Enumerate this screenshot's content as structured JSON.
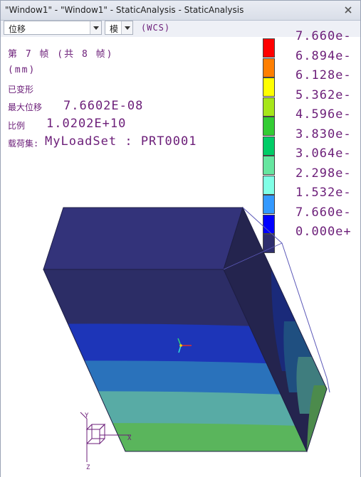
{
  "window": {
    "title": "\"Window1\" - \"Window1\" - StaticAnalysis - StaticAnalysis"
  },
  "toolbar": {
    "quantity_select": "位移",
    "component_select": "模",
    "csys": "(WCS)"
  },
  "info": {
    "frame": "第 7 帧 (共 8 帧)",
    "units": "(mm)",
    "deformed": "已变形",
    "max_disp_label": "最大位移",
    "max_disp_value": "7.6602E-08",
    "scale_label": "比例",
    "scale_value": "1.0202E+10",
    "loadset_label": "载荷集:",
    "loadset_value": "MyLoadSet : PRT0001"
  },
  "legend": {
    "entries": [
      {
        "label": "7.660e-",
        "color": "#ff0000"
      },
      {
        "label": "6.894e-",
        "color": "#ff7f00"
      },
      {
        "label": "6.128e-",
        "color": "#ffff00"
      },
      {
        "label": "5.362e-",
        "color": "#a6e619"
      },
      {
        "label": "4.596e-",
        "color": "#33cc33"
      },
      {
        "label": "3.830e-",
        "color": "#00cc66"
      },
      {
        "label": "3.064e-",
        "color": "#66e6a0"
      },
      {
        "label": "2.298e-",
        "color": "#80ffe6"
      },
      {
        "label": "1.532e-",
        "color": "#3399ff"
      },
      {
        "label": "7.660e-",
        "color": "#0000ff"
      },
      {
        "label": "0.000e+",
        "color": "#2e2e6e"
      }
    ]
  },
  "triad": {
    "x_axis": "X",
    "y_axis": "Y",
    "z_axis": "Z"
  }
}
